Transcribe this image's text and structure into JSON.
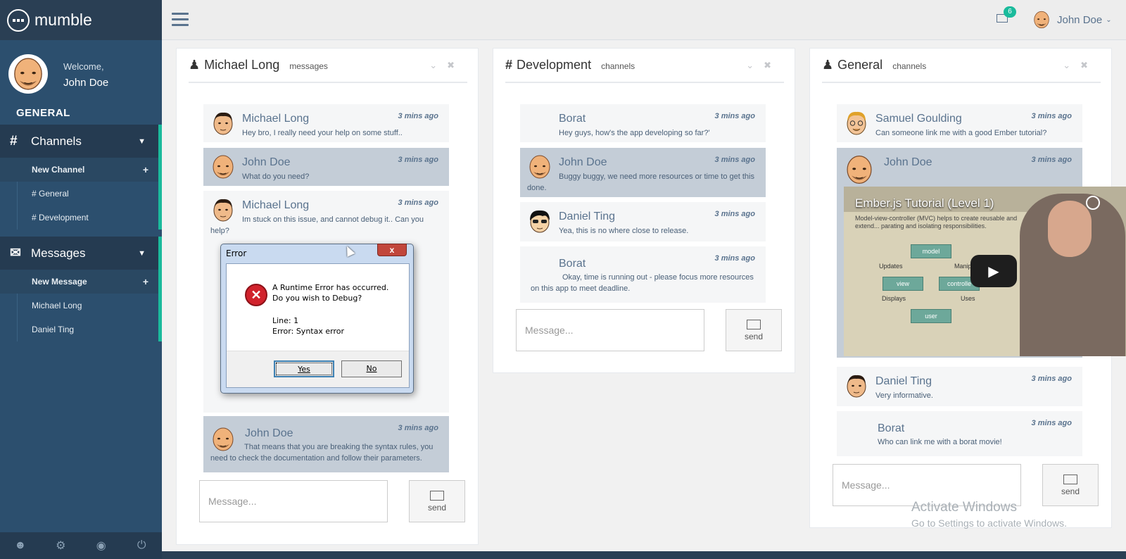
{
  "brand": {
    "name": "mumble"
  },
  "profile": {
    "welcome": "Welcome,",
    "name": "John Doe"
  },
  "sidebar": {
    "section_title": "GENERAL",
    "channels": {
      "label": "Channels",
      "icon": "hash-icon",
      "items": [
        {
          "label": "New Channel"
        },
        {
          "label": "# General"
        },
        {
          "label": "# Development"
        }
      ]
    },
    "messages": {
      "label": "Messages",
      "icon": "envelope-icon",
      "items": [
        {
          "label": "New Message"
        },
        {
          "label": "Michael Long"
        },
        {
          "label": "Daniel Ting"
        }
      ]
    },
    "footer_icons": [
      "user-icon",
      "gear-icon",
      "eye-slash-icon",
      "power-icon"
    ]
  },
  "topnav": {
    "mail_count": "6",
    "user_name": "John Doe"
  },
  "panels": [
    {
      "title": "Michael Long",
      "subtitle": "messages",
      "icon": "user-icon",
      "messages": [
        {
          "name": "Michael Long",
          "time": "3 mins ago",
          "text": "Hey bro, I really need your help on some stuff.."
        },
        {
          "name": "John Doe",
          "time": "3 mins ago",
          "text": "What do you need?"
        },
        {
          "name": "Michael Long",
          "time": "3 mins ago",
          "text": "Im stuck on this issue, and cannot debug it.. Can you help?"
        },
        {
          "name": "John Doe",
          "time": "3 mins ago",
          "text": "That means that you are breaking the syntax rules, you need to check the documentation and follow their parameters."
        }
      ],
      "input_placeholder": "Message...",
      "send_label": "send"
    },
    {
      "title": "Development",
      "subtitle": "channels",
      "icon": "hash-icon",
      "messages": [
        {
          "name": "Borat",
          "time": "3 mins ago",
          "text": "Hey guys, how's the app developing so far?'"
        },
        {
          "name": "John Doe",
          "time": "3 mins ago",
          "text": "Buggy buggy, we need more resources or time to get this done."
        },
        {
          "name": "Daniel Ting",
          "time": "3 mins ago",
          "text": "Yea, this is no where close to release."
        },
        {
          "name": "Borat",
          "time": "3 mins ago",
          "text": "Okay, time is running out - please focus more resources on this app to meet deadline."
        }
      ],
      "input_placeholder": "Message...",
      "send_label": "send"
    },
    {
      "title": "General",
      "subtitle": "channels",
      "icon": "user-icon",
      "messages": [
        {
          "name": "Samuel Goulding",
          "time": "3 mins ago",
          "text": "Can someone link me with a good Ember tutorial?"
        },
        {
          "name": "John Doe",
          "time": "3 mins ago",
          "text": ""
        },
        {
          "name": "Daniel Ting",
          "time": "3 mins ago",
          "text": "Very informative."
        },
        {
          "name": "Borat",
          "time": "3 mins ago",
          "text": "Who can link me with a borat movie!"
        }
      ],
      "input_placeholder": "Message...",
      "send_label": "send"
    }
  ],
  "error_dialog": {
    "title": "Error",
    "close_label": "x",
    "line1": "A Runtime Error has occurred.",
    "line2": "Do you wish to Debug?",
    "line3": "Line: 1",
    "line4": "Error: Syntax error",
    "yes_label": "Yes",
    "no_label": "No"
  },
  "video": {
    "title": "Ember.js Tutorial (Level 1)",
    "subtitle": "Model-view-controller (MVC) helps to create reusable and extend... parating and isolating responsibilities.",
    "diagram": {
      "model": "model",
      "view": "view",
      "controller": "controlle",
      "user": "user",
      "updates": "Updates",
      "manipulates": "Manipulat",
      "displays": "Displays",
      "uses": "Uses"
    }
  },
  "watermark": {
    "line1": "Activate Windows",
    "line2": "Go to Settings to activate Windows."
  },
  "colors": {
    "sidebar": "#2c4f6e",
    "accent": "#1abb9c",
    "highlight_msg": "#c4cdd7"
  }
}
